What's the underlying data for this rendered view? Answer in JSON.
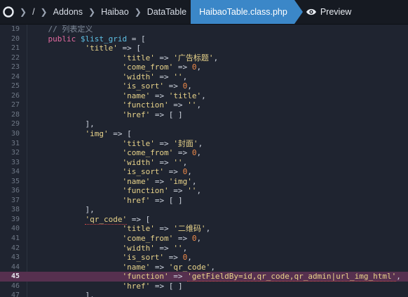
{
  "breadcrumb": {
    "root": "/",
    "items": [
      "Addons",
      "Haibao",
      "DataTable"
    ],
    "active_file": "HaibaoTable.class.php",
    "preview_label": "Preview"
  },
  "highlight_line": 45,
  "code_lines": [
    {
      "n": "19",
      "html": "    <span class='cm'>// 列表定义</span>"
    },
    {
      "n": "20",
      "html": "    <span class='kw'>public</span> <span class='var'>$list_grid</span> = ["
    },
    {
      "n": "21",
      "html": "            <span class='str'>'title'</span> => ["
    },
    {
      "n": "22",
      "html": "                    <span class='str'>'title'</span> => <span class='str'>'广告标题'</span>,"
    },
    {
      "n": "23",
      "html": "                    <span class='str'>'come_from'</span> => <span class='num'>0</span>,"
    },
    {
      "n": "24",
      "html": "                    <span class='str'>'width'</span> => <span class='str'>''</span>,"
    },
    {
      "n": "25",
      "html": "                    <span class='str'>'is_sort'</span> => <span class='num'>0</span>,"
    },
    {
      "n": "26",
      "html": "                    <span class='str'>'name'</span> => <span class='str'>'title'</span>,"
    },
    {
      "n": "27",
      "html": "                    <span class='str'>'function'</span> => <span class='str'>''</span>,"
    },
    {
      "n": "28",
      "html": "                    <span class='str'>'href'</span> => [ ]"
    },
    {
      "n": "29",
      "html": "            ],"
    },
    {
      "n": "30",
      "html": "            <span class='str'>'img'</span> => ["
    },
    {
      "n": "31",
      "html": "                    <span class='str'>'title'</span> => <span class='str'>'封面'</span>,"
    },
    {
      "n": "32",
      "html": "                    <span class='str'>'come_from'</span> => <span class='num'>0</span>,"
    },
    {
      "n": "33",
      "html": "                    <span class='str'>'width'</span> => <span class='str'>''</span>,"
    },
    {
      "n": "34",
      "html": "                    <span class='str'>'is_sort'</span> => <span class='num'>0</span>,"
    },
    {
      "n": "35",
      "html": "                    <span class='str'>'name'</span> => <span class='str'>'img'</span>,"
    },
    {
      "n": "36",
      "html": "                    <span class='str'>'function'</span> => <span class='str'>''</span>,"
    },
    {
      "n": "37",
      "html": "                    <span class='str'>'href'</span> => [ ]"
    },
    {
      "n": "38",
      "html": "            ],"
    },
    {
      "n": "39",
      "html": "            <span class='str squig'>'qr_code'</span> => ["
    },
    {
      "n": "40",
      "html": "                    <span class='str'>'title'</span> => <span class='str'>'二维码'</span>,"
    },
    {
      "n": "41",
      "html": "                    <span class='str'>'come_from'</span> => <span class='num'>0</span>,"
    },
    {
      "n": "42",
      "html": "                    <span class='str'>'width'</span> => <span class='str'>''</span>,"
    },
    {
      "n": "43",
      "html": "                    <span class='str'>'is_sort'</span> => <span class='num'>0</span>,"
    },
    {
      "n": "44",
      "html": "                    <span class='str'>'name'</span> => <span class='str squig'>'qr_code'</span>,"
    },
    {
      "n": "45",
      "html": "                    <span class='str'>'function'</span> => <span class='str squig'>'getFieldBy=id,qr_code,qr_admin|url_img_html'</span>,"
    },
    {
      "n": "46",
      "html": "                    <span class='str'>'href'</span> => [ ]"
    },
    {
      "n": "47",
      "html": "            ],"
    }
  ]
}
